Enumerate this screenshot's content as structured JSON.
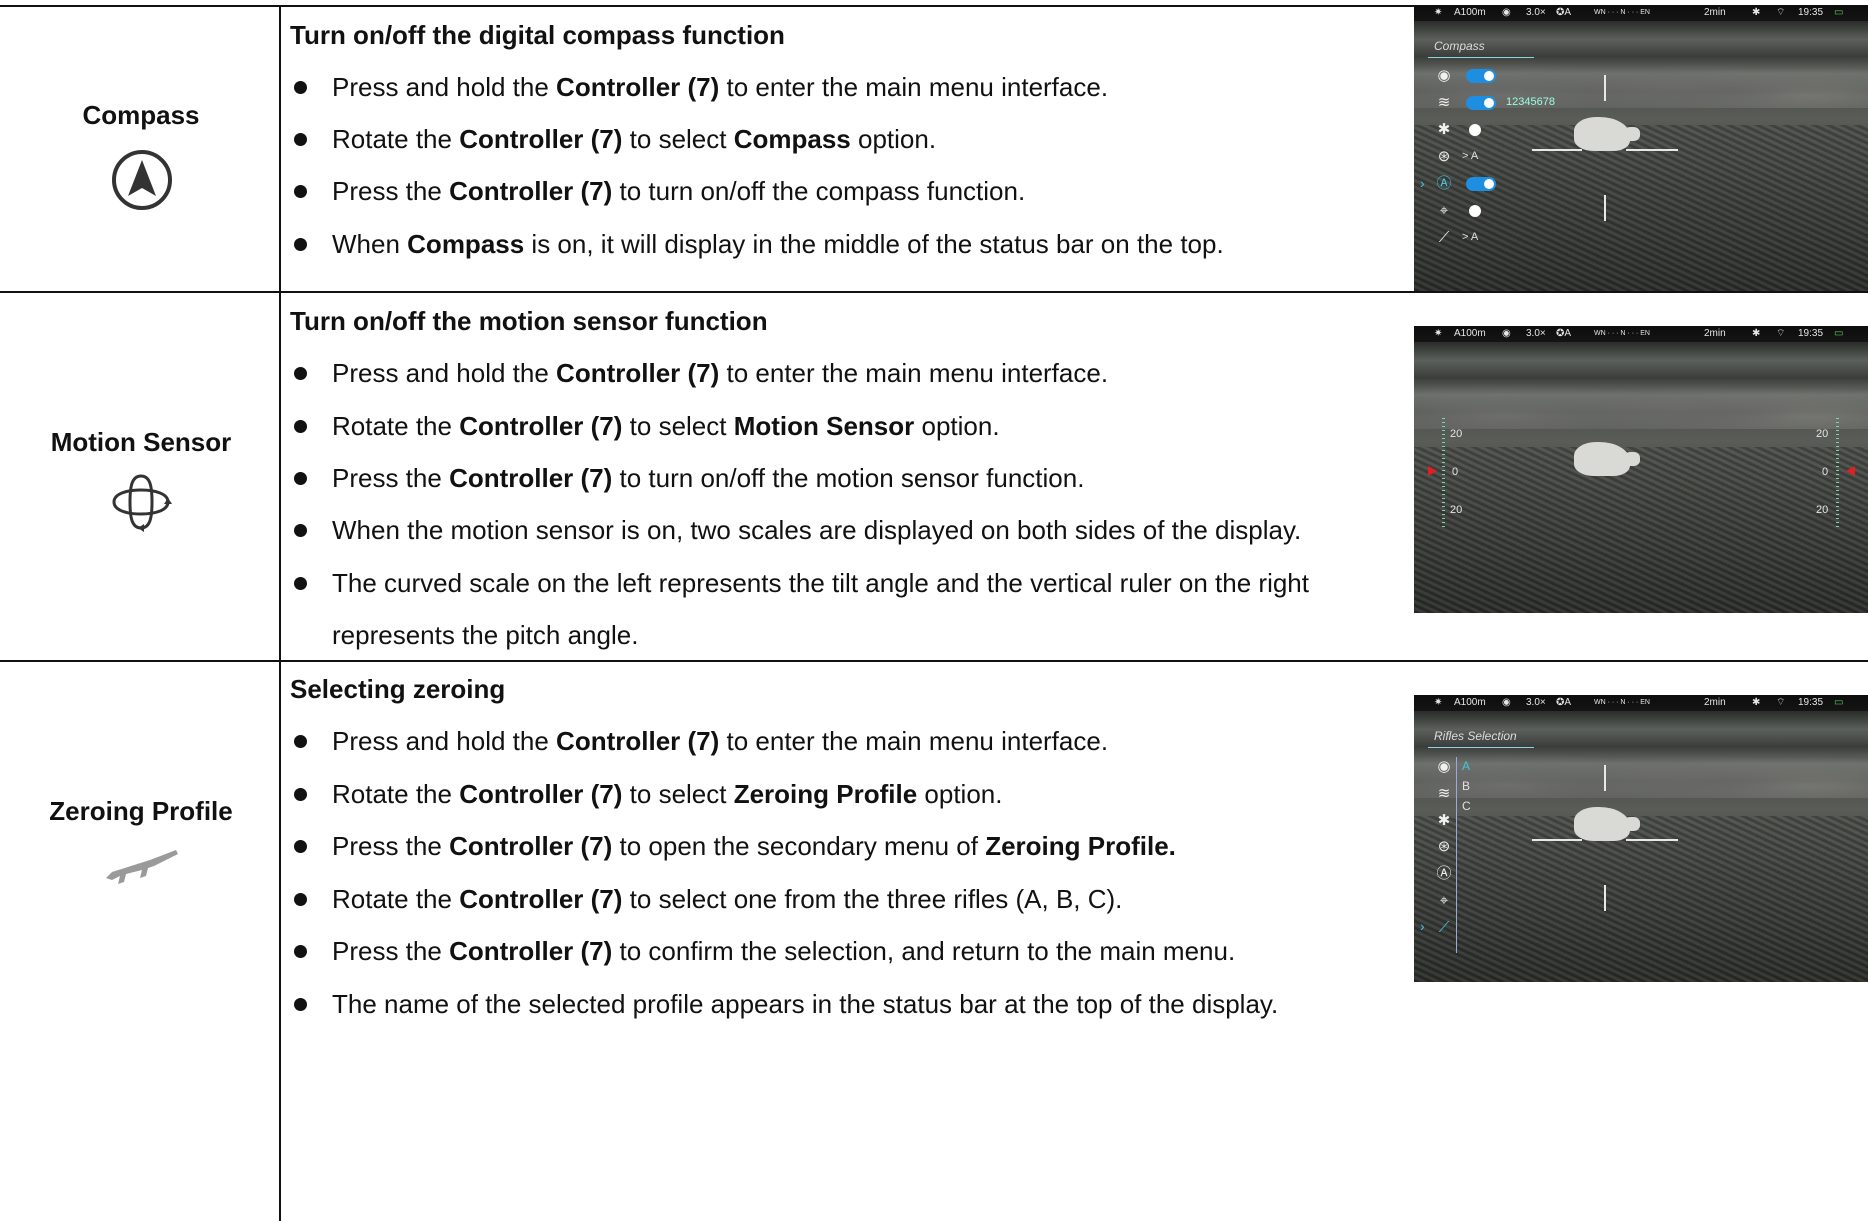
{
  "rows": [
    {
      "label": "Compass",
      "icon": "compass-icon",
      "title": "Turn on/off the digital compass function",
      "bullets": [
        [
          "Press and hold the ",
          "Controller (7)",
          " to enter the main menu interface."
        ],
        [
          "Rotate the ",
          "Controller (7)",
          " to select ",
          "Compass",
          " option."
        ],
        [
          "Press the ",
          "Controller (7)",
          " to turn on/off the compass function."
        ],
        [
          "When ",
          "Compass",
          " is on, it will display in the middle of the status bar on the top."
        ]
      ]
    },
    {
      "label": "Motion Sensor",
      "icon": "motion-sensor-icon",
      "title": "Turn on/off the motion sensor function",
      "bullets": [
        [
          "Press and hold the ",
          "Controller (7)",
          " to enter the main menu interface."
        ],
        [
          "Rotate the ",
          "Controller (7)",
          " to select ",
          "Motion Sensor",
          " option."
        ],
        [
          "Press the ",
          "Controller (7)",
          " to turn on/off the motion sensor function."
        ],
        [
          "When the motion sensor is on, two scales are displayed on both sides of the display."
        ],
        [
          "The curved scale on the left represents the tilt angle and the vertical ruler on the right"
        ]
      ],
      "continuation": "represents the pitch angle."
    },
    {
      "label": "Zeroing Profile",
      "icon": "rifle-icon",
      "title": "Selecting zeroing",
      "bullets": [
        [
          "Press and hold the ",
          "Controller (7)",
          " to enter the main menu interface."
        ],
        [
          "Rotate the ",
          "Controller (7)",
          " to select ",
          "Zeroing Profile",
          " option."
        ],
        [
          "Press the ",
          "Controller (7)",
          " to open the secondary menu of ",
          "Zeroing Profile.",
          ""
        ],
        [
          "Rotate the ",
          "Controller (7)",
          " to select one from the three rifles (A, B, C)."
        ],
        [
          "Press the ",
          "Controller (7)",
          " to confirm the selection, and return to the main menu."
        ],
        [
          "The name of the selected profile appears in the status bar at the top of the display."
        ]
      ]
    }
  ],
  "screens": {
    "status": {
      "range": "A100m",
      "zoom": "3.0×",
      "mode": "A",
      "compass_text": "WN · · · N · · · EN",
      "timer": "2min",
      "time": "19:35"
    },
    "compass_menu": {
      "title": "Compass",
      "hotspot_name": "12345678",
      "mode_a_1": "> A",
      "mode_a_2": "> A"
    },
    "motion": {
      "top": "20",
      "mid": "0",
      "bottom": "20"
    },
    "rifles_menu": {
      "title": "Rifles Selection",
      "options": [
        "A",
        "B",
        "C"
      ]
    }
  },
  "colors": {
    "accent": "#1e8fe0",
    "selected": "#41c6e0",
    "scale": "#7fd3a8"
  }
}
